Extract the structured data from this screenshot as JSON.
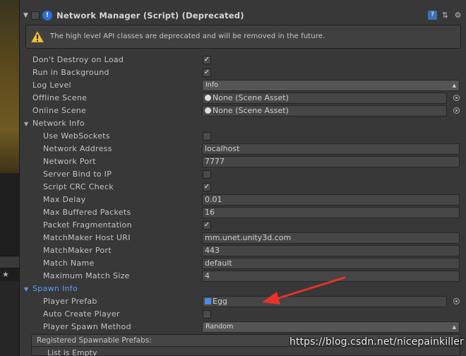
{
  "component": {
    "title": "Network Manager (Script) (Deprecated)",
    "script_icon": "script-info-icon",
    "header_icons": [
      "book-help-icon",
      "preset-sliders-icon",
      "gear-icon"
    ]
  },
  "warning": {
    "text": "The high level API classes are deprecated and will be removed in the future."
  },
  "fields": {
    "dont_destroy": {
      "label": "Don't Destroy on Load",
      "checked": "✓"
    },
    "run_background": {
      "label": "Run in Background",
      "checked": "✓"
    },
    "log_level": {
      "label": "Log Level",
      "value": "Info"
    },
    "offline_scene": {
      "label": "Offline Scene",
      "value": "None (Scene Asset)"
    },
    "online_scene": {
      "label": "Online Scene",
      "value": "None (Scene Asset)"
    }
  },
  "network_info": {
    "label": "Network Info",
    "use_websockets": {
      "label": "Use WebSockets",
      "checked": ""
    },
    "network_address": {
      "label": "Network Address",
      "value": "localhost"
    },
    "network_port": {
      "label": "Network Port",
      "value": "7777"
    },
    "server_bind": {
      "label": "Server Bind to IP",
      "checked": ""
    },
    "script_crc": {
      "label": "Script CRC Check",
      "checked": "✓"
    },
    "max_delay": {
      "label": "Max Delay",
      "value": "0.01"
    },
    "max_buffered": {
      "label": "Max Buffered Packets",
      "value": "16"
    },
    "packet_frag": {
      "label": "Packet Fragmentation",
      "checked": "✓"
    },
    "mm_host": {
      "label": "MatchMaker Host URI",
      "value": "mm.unet.unity3d.com"
    },
    "mm_port": {
      "label": "MatchMaker Port",
      "value": "443"
    },
    "match_name": {
      "label": "Match Name",
      "value": "default"
    },
    "max_match": {
      "label": "Maximum Match Size",
      "value": "4"
    }
  },
  "spawn_info": {
    "label": "Spawn Info",
    "player_prefab": {
      "label": "Player Prefab",
      "value": "Egg"
    },
    "auto_create": {
      "label": "Auto Create Player",
      "checked": ""
    },
    "spawn_method": {
      "label": "Player Spawn Method",
      "value": "Random"
    },
    "registered": {
      "header": "Registered Spawnable Prefabs:",
      "empty": "List is Empty"
    }
  },
  "watermark": "https://blog.csdn.net/nicepainkiller",
  "colors": {
    "accent_blue": "#5f9cf4",
    "warning_yellow": "#f2c335",
    "annotation_red": "#e8322a"
  }
}
